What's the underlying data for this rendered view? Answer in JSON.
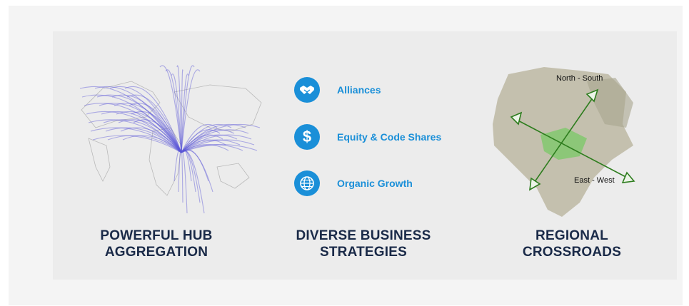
{
  "sections": {
    "hub": {
      "title_line1": "POWERFUL HUB",
      "title_line2": "AGGREGATION"
    },
    "strategies": {
      "title_line1": "DIVERSE BUSINESS",
      "title_line2": "STRATEGIES",
      "items": [
        {
          "label": "Alliances",
          "icon": "handshake-icon"
        },
        {
          "label": "Equity & Code Shares",
          "icon": "dollar-icon"
        },
        {
          "label": "Organic Growth",
          "icon": "globe-icon"
        }
      ]
    },
    "crossroads": {
      "title_line1": "REGIONAL",
      "title_line2": "CROSSROADS",
      "north_south_label": "North - South",
      "east_west_label": "East - West"
    }
  },
  "colors": {
    "accent_blue": "#1a8fd8",
    "heading_navy": "#1a2a48",
    "route_purple": "#5a57d6",
    "arrow_green": "#2e7d1e"
  }
}
